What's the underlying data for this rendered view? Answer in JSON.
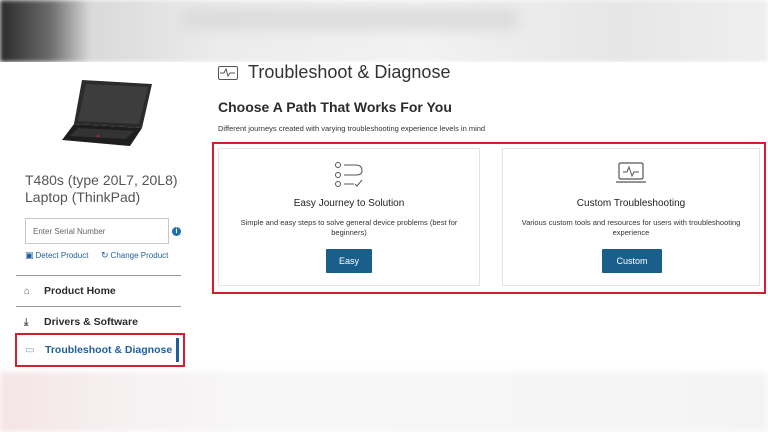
{
  "product": {
    "name": "T480s (type 20L7, 20L8) Laptop (ThinkPad)",
    "serial_placeholder": "Enter Serial Number",
    "detect_label": "Detect Product",
    "change_label": "Change Product"
  },
  "nav": {
    "items": [
      {
        "label": "Product Home",
        "icon": "home-icon"
      },
      {
        "label": "Drivers & Software",
        "icon": "download-icon"
      },
      {
        "label": "Troubleshoot & Diagnose",
        "icon": "monitor-icon",
        "active": true
      }
    ]
  },
  "main": {
    "title": "Troubleshoot & Diagnose",
    "subtitle": "Choose A Path That Works For You",
    "caption": "Different journeys created with varying troubleshooting experience levels in mind",
    "cards": [
      {
        "title": "Easy Journey to Solution",
        "description": "Simple and easy steps to solve general device problems (best for beginners)",
        "button": "Easy",
        "icon": "checklist-icon"
      },
      {
        "title": "Custom Troubleshooting",
        "description": "Various custom tools and resources for users with troubleshooting experience",
        "button": "Custom",
        "icon": "laptop-pulse-icon"
      }
    ]
  },
  "colors": {
    "accent": "#1a5f8c",
    "highlight_border": "#d0202e",
    "link": "#1f5f9c"
  }
}
